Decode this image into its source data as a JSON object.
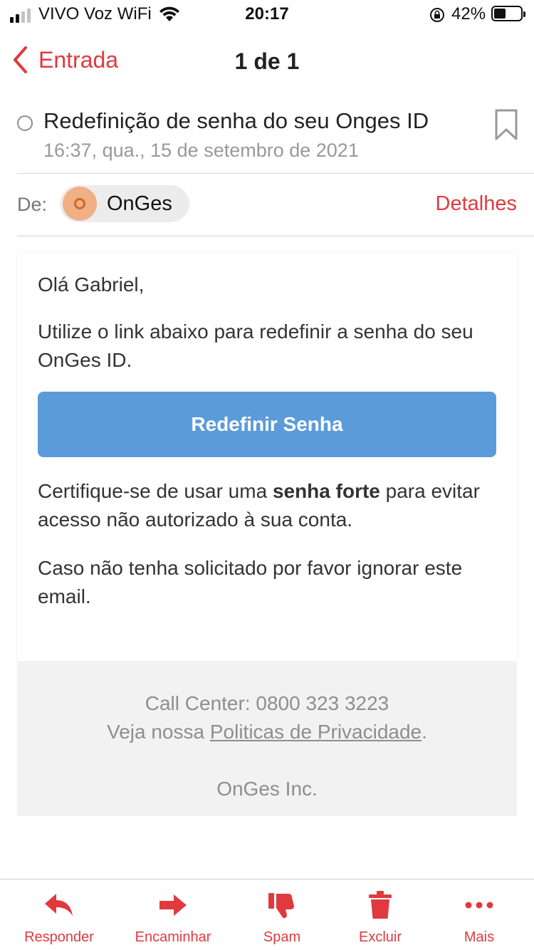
{
  "status_bar": {
    "carrier": "VIVO Voz WiFi",
    "time": "20:17",
    "battery": "42%",
    "battery_level": 0.42
  },
  "nav": {
    "back_label": "Entrada",
    "title": "1 de 1"
  },
  "email": {
    "subject": "Redefinição de senha do seu Onges ID",
    "date": "16:37, qua., 15 de setembro de 2021",
    "from_label": "De:",
    "sender": "OnGes",
    "details_label": "Detalhes",
    "greeting": "Olá Gabriel,",
    "intro": "Utilize o link abaixo para redefinir a senha do seu OnGes ID.",
    "cta_label": "Redefinir Senha",
    "warning_before": "Certifique-se de usar uma ",
    "warning_bold": "senha forte",
    "warning_after": " para evitar acesso não autorizado à sua conta.",
    "ignore_note": "Caso não tenha solicitado por favor ignorar este email.",
    "footer": {
      "call_center": "Call Center: 0800 323 3223",
      "policy_prefix": "Veja nossa ",
      "policy_link": "Politicas de Privacidade",
      "policy_suffix": ".",
      "company": "OnGes Inc."
    }
  },
  "toolbar": {
    "reply": "Responder",
    "forward": "Encaminhar",
    "spam": "Spam",
    "delete": "Excluir",
    "more": "Mais"
  },
  "colors": {
    "accent": "#e03a3e",
    "button_blue": "#5b9bd9",
    "footer_bg": "#f2f2f2"
  }
}
